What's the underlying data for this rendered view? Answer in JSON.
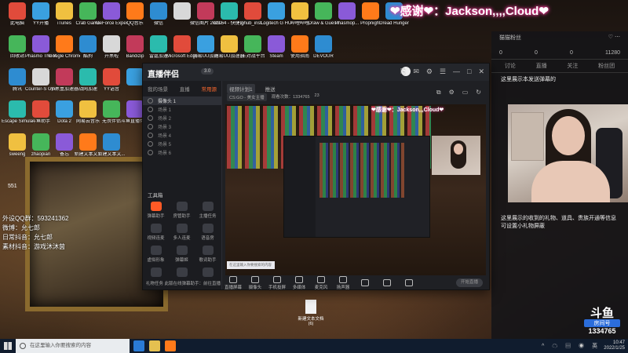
{
  "desktop": {
    "icons_row1": [
      "此电脑",
      "YY开播",
      "iTunes",
      "Crab Game",
      "GeForce Experience",
      "QQ音乐",
      "微信",
      "",
      "微信图片 2021111...",
      "obs64 - 快捷方式",
      "lghub_inst...",
      "Logitech G HUB",
      "哔哩哔哩",
      "Draw & Guess",
      "Phasmop...",
      "Propnight",
      "Dread Hunger"
    ],
    "icons_row2": [
      "回收站",
      "Phasmo The Wine Sour...",
      "Google Chrome",
      "酷狗",
      "开黑啦",
      "Bandizip",
      "雷霆加速",
      "Microsoft Edge",
      "网易UU加速",
      "网易UU加速器",
      "5E对战平台",
      "Steam",
      "使用指南",
      "DEVOUR"
    ],
    "icons_row3": [
      "腾讯",
      "Counter-S Global Off...",
      "小黑盒加速器",
      "战网加速",
      "YY语音",
      "",
      "",
      ""
    ],
    "icons_row4": [
      "Escape Simulator",
      "斗鱼助手",
      "Dota 2",
      "网易云音乐",
      "无畏伴侣",
      "斗鱼直播伴侣"
    ],
    "icons_row5": [
      "sweeng",
      "zhaopian",
      "备忘",
      "新建文本文...",
      "新建文本文..."
    ],
    "corner_number": "551",
    "overlay_lines": [
      "外设QQ群：593241362",
      "微博：允七郎",
      "日常抖音：允七郎",
      "素材抖音：游戏沐沐茵"
    ],
    "banner": "❤感谢❤：Jackson,,,,Cloud❤",
    "new_file_label": "新建文本文档 (6)"
  },
  "chat": {
    "header_left": "猫猫粉丝",
    "header_icons": "♡ ⋯",
    "stats": [
      "0",
      "0",
      "0",
      "11280"
    ],
    "tabs": [
      "讨论",
      "直播",
      "关注",
      "粉丝团"
    ],
    "message1": "这里展示本发送弹幕的",
    "message2": "这里展示的收到的礼物、道具、贵族开通等信息可设置小礼物屏蔽"
  },
  "douyu": {
    "logo": "斗鱼",
    "room_label": "房间号",
    "room_id": "1334765",
    "clock_time": "10:47",
    "clock_date": "2022/1/25"
  },
  "app": {
    "logo": "直播伴侣",
    "version": "3.0",
    "win_buttons": [
      "⎘",
      "✉",
      "⚙",
      "☰",
      "—",
      "□",
      "✕"
    ],
    "left_tabs": [
      "我的场景",
      "直播",
      "常用源"
    ],
    "active_left_tab": "常用源",
    "scenes": [
      "摄像头 1",
      "场景 1",
      "场景 2",
      "场景 3",
      "场景 4",
      "场景 5",
      "场景 6"
    ],
    "tools_header": "工具箱",
    "tools": [
      "弹幕助手",
      "房管助手",
      "主播任务",
      "视频连麦",
      "多人连麦",
      "语音房",
      "虚拟形象",
      "弹幕姬",
      "歌词助手",
      "",
      "",
      ""
    ],
    "left_footer": "礼物任务  此版在线弹幕助手：前往直播",
    "main_tabs": [
      "视频计划1",
      "推送"
    ],
    "info_chips": [
      "CS:GO - 美女主播",
      "观看次数：1334765",
      "23"
    ],
    "toolbar2": [
      "⧉",
      "⚙",
      "▭",
      "↻"
    ],
    "preview_banner": "❤感谢❤：Jackson,,,Cloud❤",
    "preview_search": "在这里输入你要搜索的内容",
    "controls": [
      "直播屏幕",
      "摄像头",
      "手机投屏",
      "多媒体",
      "麦克风",
      "扬声器",
      "",
      "",
      ""
    ],
    "start_label": "开始直播"
  },
  "taskbar": {
    "search_placeholder": "在这里输入你要搜索的内容",
    "tray_icons": "^ ☁ ▤ ◉ 英",
    "time": "10:47",
    "date": "2022/1/25"
  },
  "colors": {
    "accent": "#ff5a26",
    "banner_glow": "#ff3da0",
    "taskbar": "#101c2e"
  }
}
